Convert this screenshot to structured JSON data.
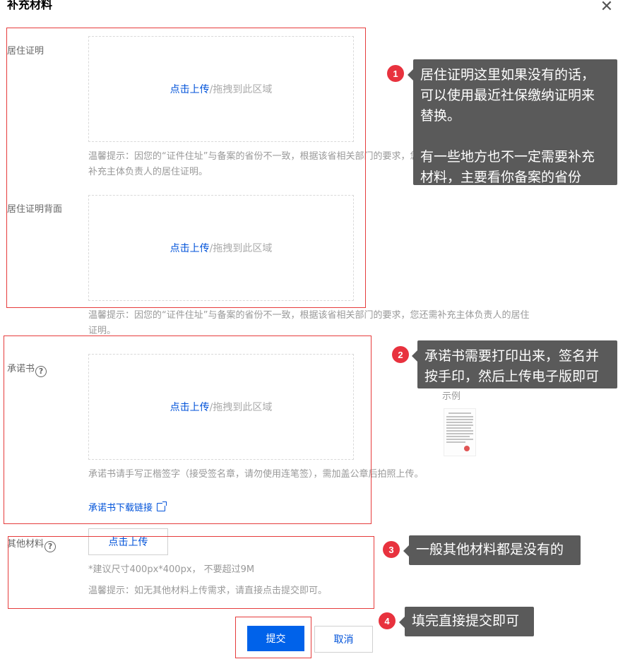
{
  "dialog": {
    "title": "补充材料",
    "close_icon": "close-icon"
  },
  "upload": {
    "link_text": "点击上传",
    "rest_text": "/拖拽到此区域"
  },
  "fields": {
    "residence_label": "居住证明",
    "residence_back_label": "居住证明背面",
    "pledge_label": "承诺书",
    "other_label": "其他材料"
  },
  "hints": {
    "residence_hint": "温馨提示：因您的“证件住址”与备案的省份不一致，根据该省相关部门的要求，您还需补充主体负责人的居住证明。",
    "residence_back_hint": "温馨提示：因您的“证件住址”与备案的省份不一致，根据该省相关部门的要求，您还需补充主体负责人的居住证明。",
    "pledge_hint": "承诺书请手写正楷签字（接受签名章，请勿使用连笔签），需加盖公章后拍照上传。",
    "pledge_download": "承诺书下载链接",
    "size_hint": "*建议尺寸400px*400px， 不要超过9M",
    "other_hint": "温馨提示：如无其他材料上传需求，请直接点击提交即可。"
  },
  "sample": {
    "label": "示例"
  },
  "buttons": {
    "upload_button": "点击上传",
    "submit": "提交",
    "cancel": "取消"
  },
  "annotations": [
    {
      "number": "1",
      "text": "居住证明这里如果没有的话，\n可以使用最近社保缴纳证明来\n替换。\n\n有一些地方也不一定需要补充\n材料，主要看你备案的省份"
    },
    {
      "number": "2",
      "text": "承诺书需要打印出来，签名并\n按手印，然后上传电子版即可"
    },
    {
      "number": "3",
      "text": "一般其他材料都是没有的"
    },
    {
      "number": "4",
      "text": "填完直接提交即可"
    }
  ],
  "colors": {
    "link_blue": "#0052d9",
    "primary_button": "#0062ea",
    "annotation_red": "#e8323e",
    "callout_gray": "#5a5a5a"
  }
}
